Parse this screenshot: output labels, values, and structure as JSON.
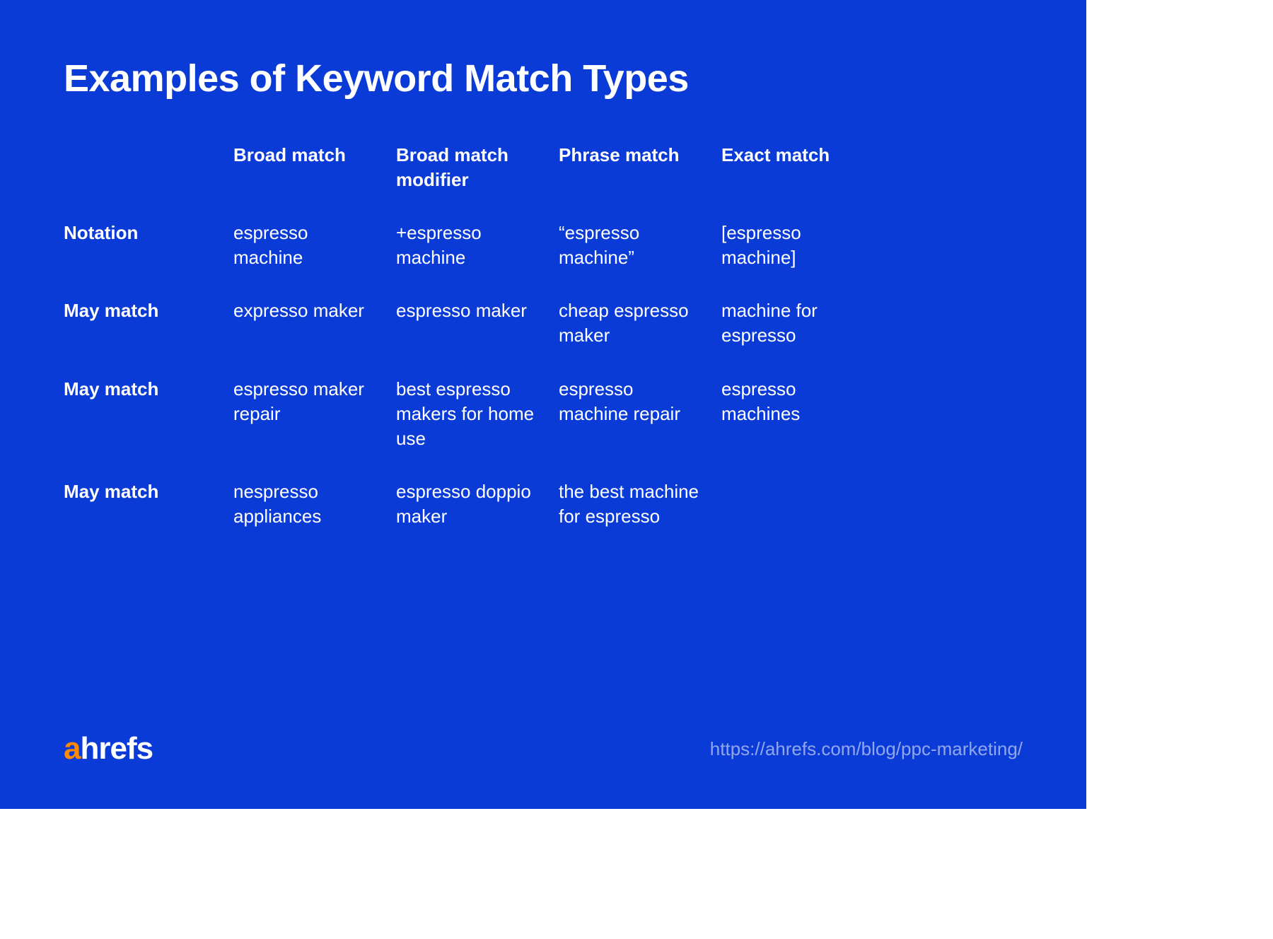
{
  "title": "Examples of Keyword Match Types",
  "columns": {
    "broad": "Broad match",
    "broad_mod": "Broad match modifier",
    "phrase": "Phrase match",
    "exact": "Exact match"
  },
  "rows": {
    "notation": {
      "label": "Notation",
      "broad": "espresso machine",
      "broad_mod": "+espresso machine",
      "phrase": "“espresso machine”",
      "exact": "[espresso machine]"
    },
    "may1": {
      "label": "May match",
      "broad": "expresso maker",
      "broad_mod": "espresso maker",
      "phrase": "cheap espresso maker",
      "exact": "machine for espresso"
    },
    "may2": {
      "label": "May match",
      "broad": "espresso maker repair",
      "broad_mod": "best espresso makers for home use",
      "phrase": "espresso machine repair",
      "exact": "espresso machines"
    },
    "may3": {
      "label": "May match",
      "broad": "nespresso appliances",
      "broad_mod": "espresso doppio maker",
      "phrase": "the best machine for espresso",
      "exact": ""
    }
  },
  "logo": {
    "a": "a",
    "rest": "hrefs"
  },
  "url": "https://ahrefs.com/blog/ppc-marketing/",
  "chart_data": {
    "type": "table",
    "title": "Examples of Keyword Match Types",
    "columns": [
      "Broad match",
      "Broad match modifier",
      "Phrase match",
      "Exact match"
    ],
    "row_labels": [
      "Notation",
      "May match",
      "May match",
      "May match"
    ],
    "data": [
      [
        "espresso machine",
        "+espresso machine",
        "\"espresso machine\"",
        "[espresso machine]"
      ],
      [
        "expresso maker",
        "espresso maker",
        "cheap espresso maker",
        "machine for espresso"
      ],
      [
        "espresso maker repair",
        "best espresso makers for home use",
        "espresso machine repair",
        "espresso machines"
      ],
      [
        "nespresso appliances",
        "espresso doppio maker",
        "the best machine for espresso",
        ""
      ]
    ]
  }
}
